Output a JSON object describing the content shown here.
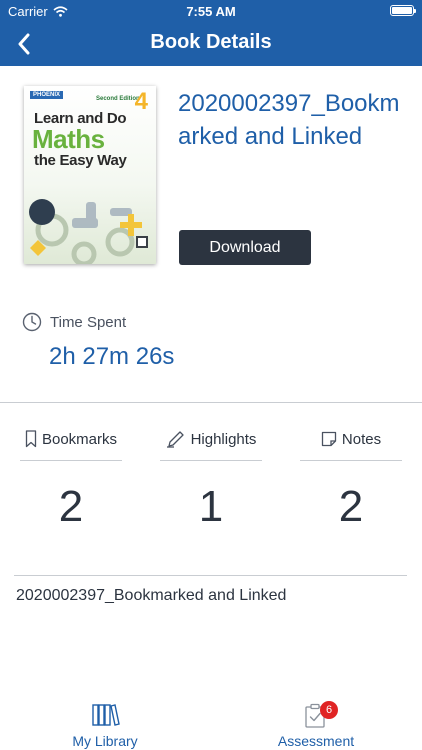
{
  "status_bar": {
    "carrier": "Carrier",
    "time": "7:55 AM"
  },
  "nav": {
    "title": "Book Details",
    "back_icon": "chevron-left-icon"
  },
  "cover": {
    "publisher": "PHOENIX",
    "edition": "Second Edition",
    "number": "4",
    "line1": "Learn and Do",
    "line2": "Maths",
    "line3": "the Easy Way"
  },
  "book": {
    "title": "2020002397_Bookmarked and Linked",
    "download_label": "Download"
  },
  "time_spent": {
    "label": "Time Spent",
    "value": "2h 27m 26s",
    "icon": "clock-icon"
  },
  "stats": [
    {
      "label": "Bookmarks",
      "count": "2",
      "icon": "bookmark-icon"
    },
    {
      "label": "Highlights",
      "count": "1",
      "icon": "pencil-icon"
    },
    {
      "label": "Notes",
      "count": "2",
      "icon": "note-icon"
    }
  ],
  "book_name_line": "2020002397_Bookmarked and Linked",
  "tabs": [
    {
      "label": "My Library",
      "icon": "library-books-icon"
    },
    {
      "label": "Assessment",
      "icon": "clipboard-check-icon",
      "badge": "6"
    }
  ],
  "colors": {
    "primary": "#1f5fa8",
    "dark": "#2c3440",
    "badge": "#e02424",
    "divider": "#c9cdd2"
  }
}
